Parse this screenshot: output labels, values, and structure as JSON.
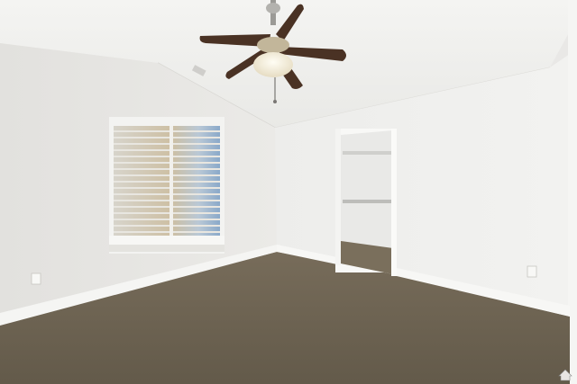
{
  "photo": {
    "subject": "room-interior",
    "elements": [
      "vaulted-ceiling",
      "ceiling-fan",
      "window-with-blinds",
      "walk-in-closet",
      "carpet-floor",
      "baseboards",
      "outlets"
    ]
  },
  "colors": {
    "wall_left": "#e6e5e2",
    "wall_right": "#eeeeec",
    "ceiling": "#f1f1ef",
    "carpet": "#6e6453",
    "baseboard": "#f6f6f4",
    "fan_blade": "#4a3224"
  },
  "watermark": {
    "icon": "home-icon"
  }
}
